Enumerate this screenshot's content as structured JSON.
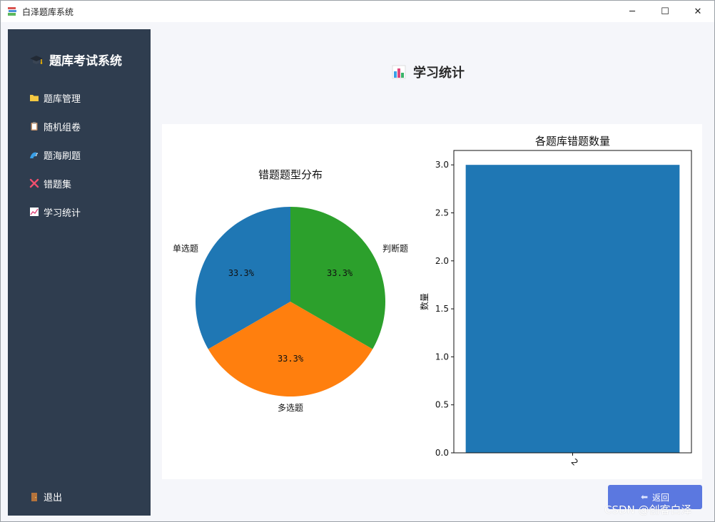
{
  "window": {
    "title": "白泽题库系统",
    "controls": {
      "minimize": "─",
      "maximize": "☐",
      "close": "✕"
    }
  },
  "sidebar": {
    "brand": "题库考试系统",
    "items": [
      {
        "label": "题库管理",
        "icon": "folder-icon"
      },
      {
        "label": "随机组卷",
        "icon": "clipboard-icon"
      },
      {
        "label": "题海刷题",
        "icon": "wave-icon"
      },
      {
        "label": "错题集",
        "icon": "cross-icon"
      },
      {
        "label": "学习统计",
        "icon": "trend-chart-icon"
      }
    ],
    "exit_label": "退出"
  },
  "page": {
    "title": "学习统计"
  },
  "chart_data": [
    {
      "type": "pie",
      "title": "错题题型分布",
      "labels": [
        "单选题",
        "多选题",
        "判断题"
      ],
      "values": [
        33.3,
        33.3,
        33.3
      ],
      "value_labels": [
        "33.3%",
        "33.3%",
        "33.3%"
      ],
      "colors": [
        "#1f77b4",
        "#ff7f0e",
        "#2ca02c"
      ]
    },
    {
      "type": "bar",
      "title": "各题库错题数量",
      "categories": [
        "2"
      ],
      "values": [
        3.0
      ],
      "ylabel": "数量",
      "xlabel": "",
      "ylim": [
        0,
        3.15
      ],
      "yticks": [
        "0.0",
        "0.5",
        "1.0",
        "1.5",
        "2.0",
        "2.5",
        "3.0"
      ],
      "color": "#1f77b4"
    }
  ],
  "back_button": {
    "label": "返回"
  },
  "watermark": "CSDN @创客白泽"
}
